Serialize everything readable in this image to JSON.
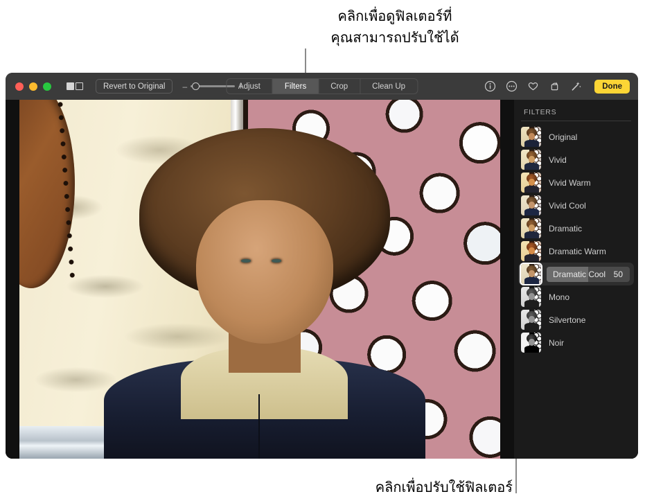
{
  "callouts": {
    "top": "คลิกเพื่อดูฟิลเตอร์ที่\nคุณสามารถปรับใช้ได้",
    "bottom": "คลิกเพื่อปรับใช้ฟิลเตอร์"
  },
  "toolbar": {
    "window_controls": [
      "close",
      "minimize",
      "zoom"
    ],
    "compare_toggle_icon": "split-view-icon",
    "revert_label": "Revert to Original",
    "zoom_minus": "–",
    "zoom_plus": "+",
    "zoom_thumb_percent": 8,
    "segments": [
      {
        "label": "Adjust",
        "active": false
      },
      {
        "label": "Filters",
        "active": true
      },
      {
        "label": "Crop",
        "active": false
      },
      {
        "label": "Clean Up",
        "active": false
      }
    ],
    "right_icons": [
      "info-icon",
      "more-options-icon",
      "favorite-heart-icon",
      "rotate-icon",
      "auto-enhance-wand-icon"
    ],
    "done_label": "Done",
    "done_color": "#fcd535"
  },
  "sidebar": {
    "title": "FILTERS",
    "filters": [
      {
        "label": "Original",
        "selected": false,
        "tint": "none"
      },
      {
        "label": "Vivid",
        "selected": false,
        "tint": "rgba(255,240,200,0.18)"
      },
      {
        "label": "Vivid Warm",
        "selected": false,
        "tint": "rgba(255,150,60,0.30)"
      },
      {
        "label": "Vivid Cool",
        "selected": false,
        "tint": "rgba(150,190,255,0.20)"
      },
      {
        "label": "Dramatic",
        "selected": false,
        "tint": "rgba(230,210,180,0.18)"
      },
      {
        "label": "Dramatic Warm",
        "selected": false,
        "tint": "rgba(255,130,50,0.32)"
      },
      {
        "label": "Dramatic Cool",
        "selected": true,
        "tint": "rgba(140,180,230,0.22)",
        "value": "50",
        "slider_percent": 50
      },
      {
        "label": "Mono",
        "selected": false,
        "tint": "grayscale"
      },
      {
        "label": "Silvertone",
        "selected": false,
        "tint": "grayscale"
      },
      {
        "label": "Noir",
        "selected": false,
        "tint": "grayscale-high"
      }
    ]
  },
  "photo": {
    "alt": "portrait of a person with curly hair in front of a crown-glass window"
  }
}
